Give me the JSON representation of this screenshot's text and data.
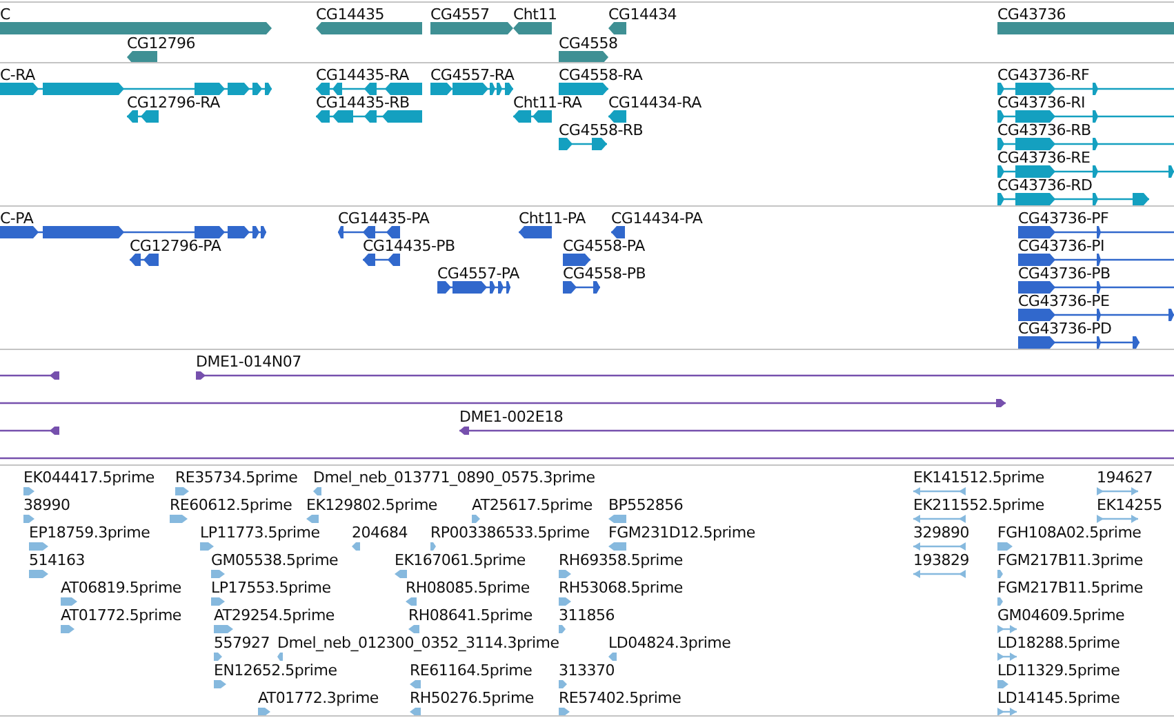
{
  "tracks": [
    {
      "kind": "gene",
      "features": [
        {
          "label": "C",
          "reverse": false
        },
        {
          "label": "CG12796",
          "reverse": true
        },
        {
          "label": "CG14435",
          "reverse": true
        },
        {
          "label": "CG4557",
          "reverse": false
        },
        {
          "label": "Cht11",
          "reverse": true
        },
        {
          "label": "CG4558",
          "reverse": false
        },
        {
          "label": "CG14434",
          "reverse": true
        },
        {
          "label": "CG43736",
          "reverse": false
        }
      ]
    },
    {
      "kind": "mrna",
      "features": [
        {
          "label": "C-RA",
          "reverse": false
        },
        {
          "label": "CG12796-RA",
          "reverse": true
        },
        {
          "label": "CG14435-RA",
          "reverse": true
        },
        {
          "label": "CG14435-RB",
          "reverse": true
        },
        {
          "label": "CG4557-RA",
          "reverse": false
        },
        {
          "label": "Cht11-RA",
          "reverse": true
        },
        {
          "label": "CG4558-RA",
          "reverse": false
        },
        {
          "label": "CG14434-RA",
          "reverse": true
        },
        {
          "label": "CG4558-RB",
          "reverse": false
        },
        {
          "label": "CG43736-RF",
          "reverse": false
        },
        {
          "label": "CG43736-RI",
          "reverse": false
        },
        {
          "label": "CG43736-RB",
          "reverse": false
        },
        {
          "label": "CG43736-RE",
          "reverse": false
        },
        {
          "label": "CG43736-RD",
          "reverse": false
        }
      ]
    },
    {
      "kind": "protein",
      "features": [
        {
          "label": "C-PA",
          "reverse": false
        },
        {
          "label": "CG12796-PA",
          "reverse": true
        },
        {
          "label": "CG14435-PA",
          "reverse": true
        },
        {
          "label": "CG14435-PB",
          "reverse": true
        },
        {
          "label": "CG4557-PA",
          "reverse": false
        },
        {
          "label": "Cht11-PA",
          "reverse": true
        },
        {
          "label": "CG14434-PA",
          "reverse": true
        },
        {
          "label": "CG4558-PA",
          "reverse": false
        },
        {
          "label": "CG4558-PB",
          "reverse": false
        },
        {
          "label": "CG43736-PF",
          "reverse": false
        },
        {
          "label": "CG43736-PI",
          "reverse": false
        },
        {
          "label": "CG43736-PB",
          "reverse": false
        },
        {
          "label": "CG43736-PE",
          "reverse": false
        },
        {
          "label": "CG43736-PD",
          "reverse": false
        }
      ]
    },
    {
      "kind": "clone",
      "features": [
        {
          "kind": "flagged",
          "reverse": true
        },
        {
          "kind": "flagged",
          "label": "DME1-014N07",
          "reverse": false
        },
        {
          "kind": "flagged",
          "reverse": false
        },
        {
          "kind": "flagged",
          "reverse": true
        },
        {
          "kind": "flagged",
          "label": "DME1-002E18",
          "reverse": true
        },
        {
          "kind": "span"
        }
      ]
    },
    {
      "kind": "est",
      "features": [
        {
          "label": "EK044417.5prime",
          "reverse": false
        },
        {
          "label": "RE35734.5prime",
          "reverse": false
        },
        {
          "label": "Dmel_neb_013771_0890_0575.3prime",
          "reverse": true
        },
        {
          "label": "EK141512.5prime",
          "reverse": true
        },
        {
          "label": "194627",
          "reverse": false
        },
        {
          "label": "38990",
          "reverse": false
        },
        {
          "label": "RE60612.5prime",
          "reverse": false
        },
        {
          "label": "EK129802.5prime",
          "reverse": true
        },
        {
          "label": "AT25617.5prime",
          "reverse": false
        },
        {
          "label": "BP552856",
          "reverse": true
        },
        {
          "label": "EK211552.5prime",
          "reverse": true
        },
        {
          "label": "EK14255",
          "reverse": false
        },
        {
          "label": "EP18759.3prime",
          "reverse": false
        },
        {
          "label": "LP11773.5prime",
          "reverse": false
        },
        {
          "label": "204684",
          "reverse": true
        },
        {
          "label": "RP003386533.5prime",
          "reverse": false
        },
        {
          "label": "FGM231D12.5prime",
          "reverse": true
        },
        {
          "label": "329890",
          "reverse": true
        },
        {
          "label": "FGH108A02.5prime",
          "reverse": false
        },
        {
          "label": "514163",
          "reverse": false
        },
        {
          "label": "GM05538.5prime",
          "reverse": false
        },
        {
          "label": "EK167061.5prime",
          "reverse": true
        },
        {
          "label": "RH69358.5prime",
          "reverse": false
        },
        {
          "label": "193829",
          "reverse": true
        },
        {
          "label": "FGM217B11.3prime",
          "reverse": false
        },
        {
          "label": "AT06819.5prime",
          "reverse": false
        },
        {
          "label": "LP17553.5prime",
          "reverse": false
        },
        {
          "label": "RH08085.5prime",
          "reverse": true
        },
        {
          "label": "RH53068.5prime",
          "reverse": false
        },
        {
          "label": "FGM217B11.5prime",
          "reverse": false
        },
        {
          "label": "AT01772.5prime",
          "reverse": false
        },
        {
          "label": "AT29254.5prime",
          "reverse": false
        },
        {
          "label": "RH08641.5prime",
          "reverse": true
        },
        {
          "label": "311856",
          "reverse": false
        },
        {
          "label": "GM04609.5prime",
          "reverse": false
        },
        {
          "label": "557927",
          "reverse": false
        },
        {
          "label": "Dmel_neb_012300_0352_3114.3prime",
          "reverse": true
        },
        {
          "label": "LD04824.3prime",
          "reverse": true
        },
        {
          "label": "LD18288.5prime",
          "reverse": false
        },
        {
          "label": "EN12652.5prime",
          "reverse": false
        },
        {
          "label": "RE61164.5prime",
          "reverse": true
        },
        {
          "label": "313370",
          "reverse": false
        },
        {
          "label": "LD11329.5prime",
          "reverse": false
        },
        {
          "label": "AT01772.3prime",
          "reverse": false
        },
        {
          "label": "RH50276.5prime",
          "reverse": true
        },
        {
          "label": "RE57402.5prime",
          "reverse": false
        },
        {
          "label": "LD14145.5prime",
          "reverse": false
        }
      ]
    }
  ]
}
